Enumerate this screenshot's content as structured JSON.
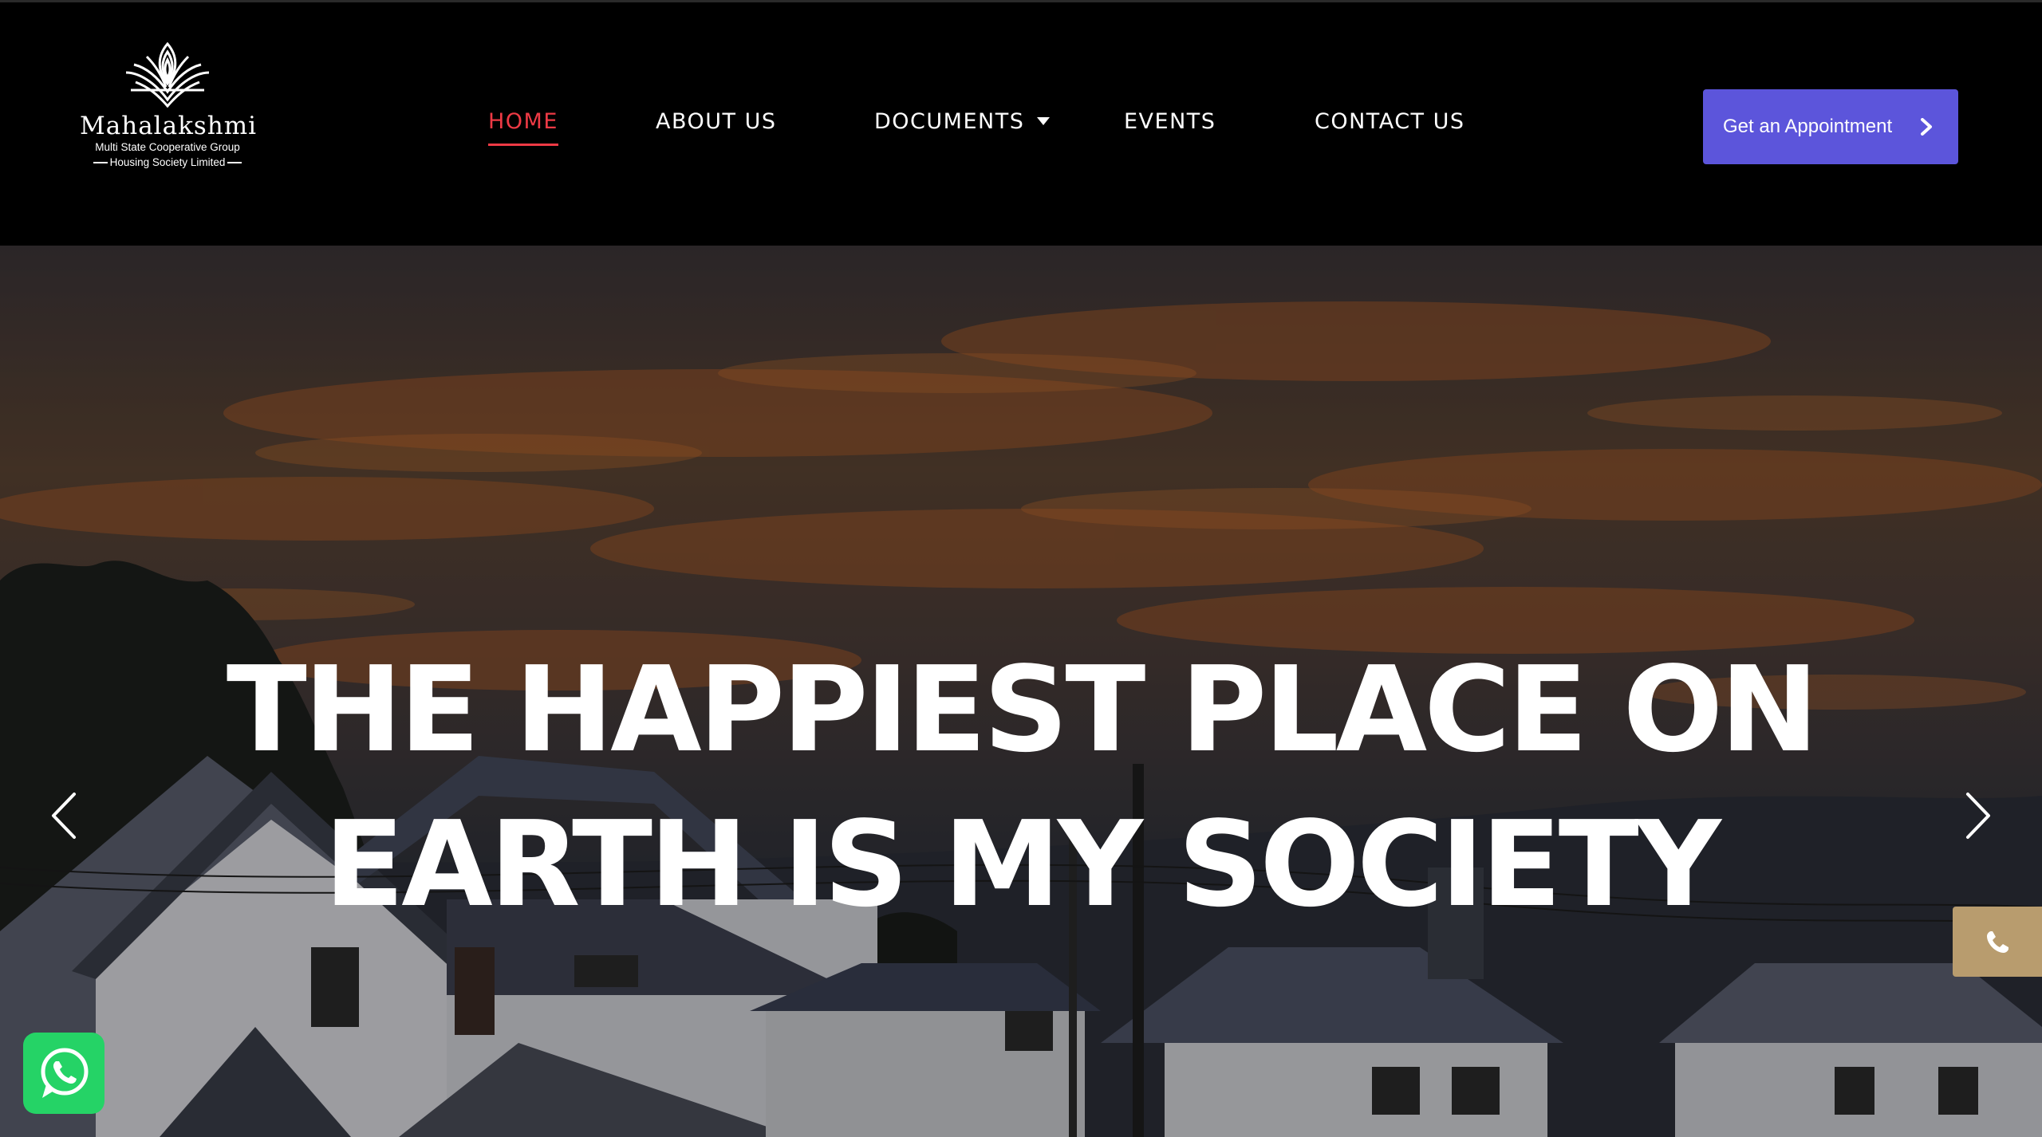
{
  "brand": {
    "name": "Mahalakshmi",
    "tagline_line1": "Multi State Cooperative Group",
    "tagline_line2": "Housing Society Limited"
  },
  "nav": {
    "items": [
      {
        "label": "HOME",
        "active": true
      },
      {
        "label": "ABOUT US",
        "active": false
      },
      {
        "label": "DOCUMENTS",
        "active": false,
        "has_dropdown": true
      },
      {
        "label": "EVENTS",
        "active": false
      },
      {
        "label": "CONTACT US",
        "active": false
      }
    ]
  },
  "cta": {
    "label": "Get an Appointment",
    "icon": "chevron-right-icon"
  },
  "hero": {
    "title_line1": "THE HAPPIEST PLACE ON",
    "title_line2": "EARTH IS MY SOCIETY",
    "prev_icon": "chevron-left-icon",
    "next_icon": "chevron-right-icon"
  },
  "floating": {
    "phone_icon": "phone-icon",
    "whatsapp_icon": "whatsapp-icon"
  },
  "colors": {
    "header_bg": "#000000",
    "active_nav": "#ee3a45",
    "cta_bg": "#5c55db",
    "phone_bg": "#b89c6e",
    "whatsapp_bg": "#25d366"
  }
}
